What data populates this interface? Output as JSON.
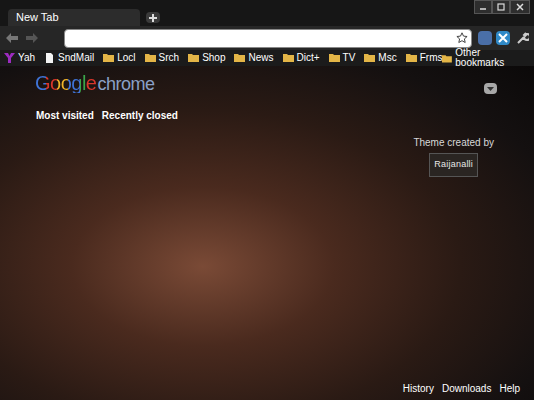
{
  "tabs": [
    {
      "label": "New Tab",
      "selected": true
    }
  ],
  "bookmarks": [
    {
      "label": "Yah",
      "kind": "yahoo"
    },
    {
      "label": "SndMail",
      "kind": "page"
    },
    {
      "label": "Locl",
      "kind": "folder"
    },
    {
      "label": "Srch",
      "kind": "folder"
    },
    {
      "label": "Shop",
      "kind": "folder"
    },
    {
      "label": "News",
      "kind": "folder"
    },
    {
      "label": "Dict+",
      "kind": "folder"
    },
    {
      "label": "TV",
      "kind": "folder"
    },
    {
      "label": "Msc",
      "kind": "folder"
    },
    {
      "label": "Frms",
      "kind": "folder"
    }
  ],
  "other_bookmarks": {
    "label": "Other bookmarks"
  },
  "logo": {
    "google": "Google",
    "chrome": "chrome"
  },
  "sections": [
    "Most visited",
    "Recently closed"
  ],
  "attribution": {
    "caption": "Theme created by",
    "author": "Raijanalli"
  },
  "footer_links": [
    "History",
    "Downloads",
    "Help"
  ]
}
